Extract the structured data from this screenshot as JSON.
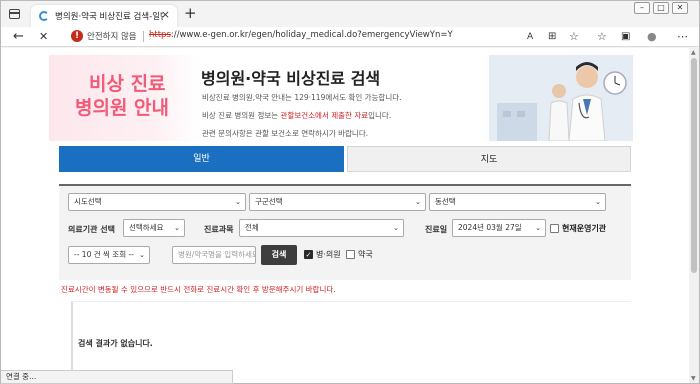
{
  "browser": {
    "tab_title": "병의원·약국 비상진료 검색-일반",
    "tab_close": "×",
    "new_tab": "+",
    "not_secure": "안전하지 않음",
    "url_scheme": "https",
    "url_rest": "://www.e-gen.or.kr/egen/holiday_medical.do?emergencyViewYn=Y",
    "back": "←",
    "stop": "✕",
    "status": "연결 중..."
  },
  "banner": {
    "big_line1": "비상 진료",
    "big_line2": "병의원 안내",
    "title": "병의원·약국 비상진료 검색",
    "line1": "비상진료 병의원,약국 안내는 129·119에서도 확인 가능합니다.",
    "line2_pre": "비상 진료 병의원 정보는 ",
    "line2_hl": "관할보건소에서 제출한 자료",
    "line2_post": "입니다.",
    "line3": "관련 문의사항은 관할 보건소로 연락하시기 바랍니다."
  },
  "tabs": {
    "general": "일반",
    "map": "지도"
  },
  "search": {
    "sido": "시도선택",
    "gugun": "구군선택",
    "dong": "동선택",
    "inst_label": "의료기관 선택",
    "inst_value": "선택하세요",
    "dept_label": "진료과목",
    "dept_value": "전체",
    "date_label": "진료일",
    "date_value": "2024년 03월 27일",
    "open_now": "현재운영기관",
    "page_size": "-- 10 건 씩 조회 --",
    "name_placeholder": "병원/약국명을 입력하세요",
    "search_button": "검색",
    "hospital": "병·의원",
    "pharmacy": "약국"
  },
  "notice": "진료시간이 변동될 수 있으므로 반드시 전화로 진료시간 확인 후 방문해주시기 바랍니다.",
  "result": "검색 결과가 없습니다."
}
